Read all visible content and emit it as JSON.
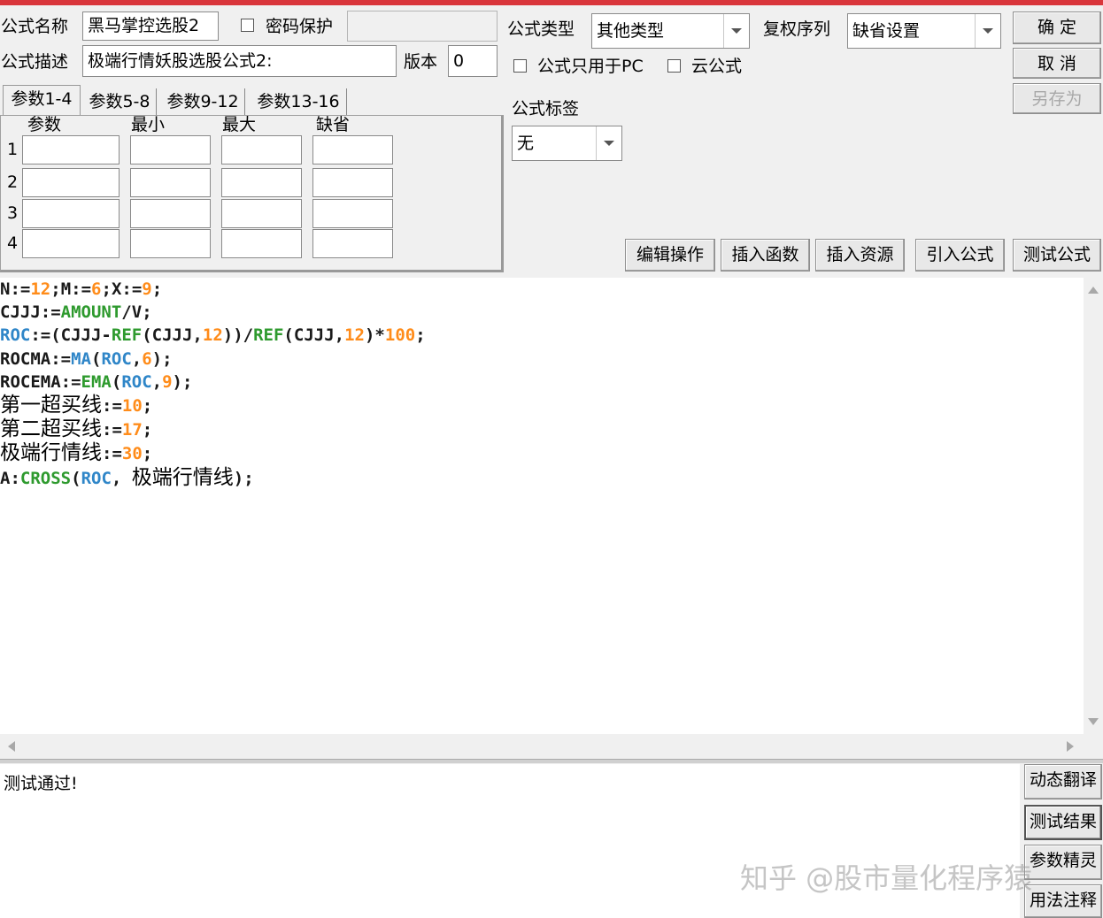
{
  "header": {
    "name_label": "公式名称",
    "name_value": "黑马掌控选股2",
    "password_label": "密码保护",
    "password_value": "",
    "desc_label": "公式描述",
    "desc_value": "极端行情妖股选股公式2:",
    "version_label": "版本",
    "version_value": "0",
    "type_label": "公式类型",
    "type_value": "其他类型",
    "rights_label": "复权序列",
    "rights_value": "缺省设置",
    "pc_only_label": "公式只用于PC",
    "cloud_label": "云公式",
    "tag_label": "公式标签",
    "tag_value": "无"
  },
  "buttons": {
    "ok": "确  定",
    "cancel": "取  消",
    "save_as": "另存为",
    "edit_ops": "编辑操作",
    "insert_func": "插入函数",
    "insert_res": "插入资源",
    "import_formula": "引入公式",
    "test_formula": "测试公式"
  },
  "tabs": [
    "参数1-4",
    "参数5-8",
    "参数9-12",
    "参数13-16"
  ],
  "params": {
    "headers": [
      "参数",
      "最小",
      "最大",
      "缺省"
    ],
    "rows": [
      "1",
      "2",
      "3",
      "4"
    ]
  },
  "code_lines": [
    "N:=12;M:=6;X:=9;",
    "CJJJ:=AMOUNT/V;",
    "ROC:=(CJJJ-REF(CJJJ,12))/REF(CJJJ,12)*100;",
    "ROCMA:=MA(ROC,6);",
    "ROCEMA:=EMA(ROC,9);",
    "第一超买线:=10;",
    "第二超买线:=17;",
    "极端行情线:=30;",
    "A:CROSS(ROC, 极端行情线);"
  ],
  "output": {
    "text": "测试通过!",
    "side_buttons": [
      "动态翻译",
      "测试结果",
      "参数精灵",
      "用法注释"
    ]
  },
  "watermark": "知乎 @股市量化程序猿",
  "colors": {
    "keyword": "#2e9a2e",
    "function": "#2f86c8",
    "number": "#ff8c1a",
    "title_bar": "#d9353b"
  }
}
